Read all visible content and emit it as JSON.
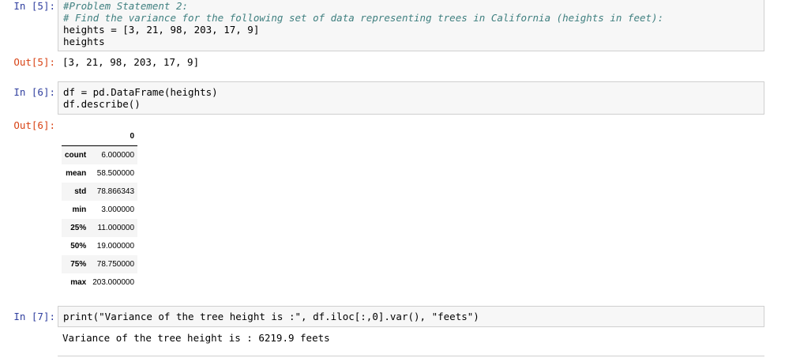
{
  "cells": [
    {
      "in_prompt": "In [5]:",
      "code_lines": [
        "#Problem Statement 2:",
        "# Find the variance for the following set of data representing trees in California (heights in feet):",
        "heights = [3, 21, 98, 203, 17, 9]",
        "heights"
      ],
      "out_prompt": "Out[5]:",
      "output_text": "[3, 21, 98, 203, 17, 9]"
    },
    {
      "in_prompt": "In [6]:",
      "code_lines": [
        "df = pd.DataFrame(heights)",
        "df.describe()"
      ],
      "out_prompt": "Out[6]:",
      "dataframe": {
        "column": "0",
        "rows": [
          {
            "index": "count",
            "value": "6.000000"
          },
          {
            "index": "mean",
            "value": "58.500000"
          },
          {
            "index": "std",
            "value": "78.866343"
          },
          {
            "index": "min",
            "value": "3.000000"
          },
          {
            "index": "25%",
            "value": "11.000000"
          },
          {
            "index": "50%",
            "value": "19.000000"
          },
          {
            "index": "75%",
            "value": "78.750000"
          },
          {
            "index": "max",
            "value": "203.000000"
          }
        ]
      }
    },
    {
      "in_prompt": "In [7]:",
      "code_lines": [
        "print(\"Variance of the tree height is :\", df.iloc[:,0].var(), \"feets\")"
      ],
      "output_text": "Variance of the tree height is : 6219.9 feets"
    }
  ],
  "colors": {
    "in_prompt": "#303f9f",
    "out_prompt": "#d84315",
    "comment": "#408080",
    "string": "#ba2121",
    "number": "#008000",
    "cell_background": "#f7f7f7"
  }
}
